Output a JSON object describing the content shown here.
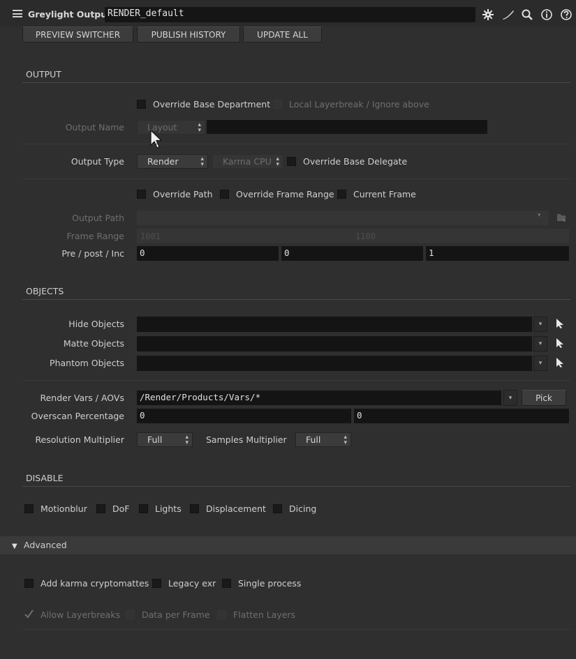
{
  "header": {
    "title": "Greylight Output",
    "node_name": "RENDER_default",
    "icons": [
      "gear-icon",
      "brush-icon",
      "search-icon",
      "info-icon",
      "help-icon"
    ]
  },
  "toolbar": {
    "preview_switcher": "PREVIEW SWITCHER",
    "publish_history": "PUBLISH HISTORY",
    "update_all": "UPDATE ALL"
  },
  "output": {
    "title": "OUTPUT",
    "override_base_department": "Override Base Department",
    "local_layerbreak": "Local Layerbreak / Ignore above",
    "output_name_label": "Output Name",
    "output_name_value": "Layout",
    "output_type_label": "Output Type",
    "output_type_value": "Render",
    "delegate_value": "Karma CPU",
    "override_base_delegate": "Override Base Delegate",
    "override_path": "Override Path",
    "override_frame_range": "Override Frame Range",
    "current_frame": "Current Frame",
    "output_path_label": "Output Path",
    "frame_range_label": "Frame Range",
    "frame_start": "1001",
    "frame_end": "1100",
    "pre_post_inc_label": "Pre / post / Inc",
    "pre": "0",
    "post": "0",
    "inc": "1"
  },
  "objects": {
    "title": "OBJECTS",
    "hide_objects": "Hide Objects",
    "matte_objects": "Matte Objects",
    "phantom_objects": "Phantom Objects",
    "render_vars_label": "Render Vars / AOVs",
    "render_vars_value": "/Render/Products/Vars/*",
    "pick": "Pick",
    "overscan_label": "Overscan Percentage",
    "overscan_x": "0",
    "overscan_y": "0",
    "resolution_multiplier_label": "Resolution Multiplier",
    "resolution_multiplier_value": "Full",
    "samples_multiplier_label": "Samples Multiplier",
    "samples_multiplier_value": "Full"
  },
  "disable": {
    "title": "DISABLE",
    "motionblur": "Motionblur",
    "dof": "DoF",
    "lights": "Lights",
    "displacement": "Displacement",
    "dicing": "Dicing"
  },
  "advanced": {
    "title": "Advanced",
    "add_karma_cryptomattes": "Add karma cryptomattes",
    "legacy_exr": "Legacy exr",
    "single_process": "Single process",
    "allow_layerbreaks": "Allow Layerbreaks",
    "data_per_frame": "Data per Frame",
    "flatten_layers": "Flatten Layers"
  }
}
